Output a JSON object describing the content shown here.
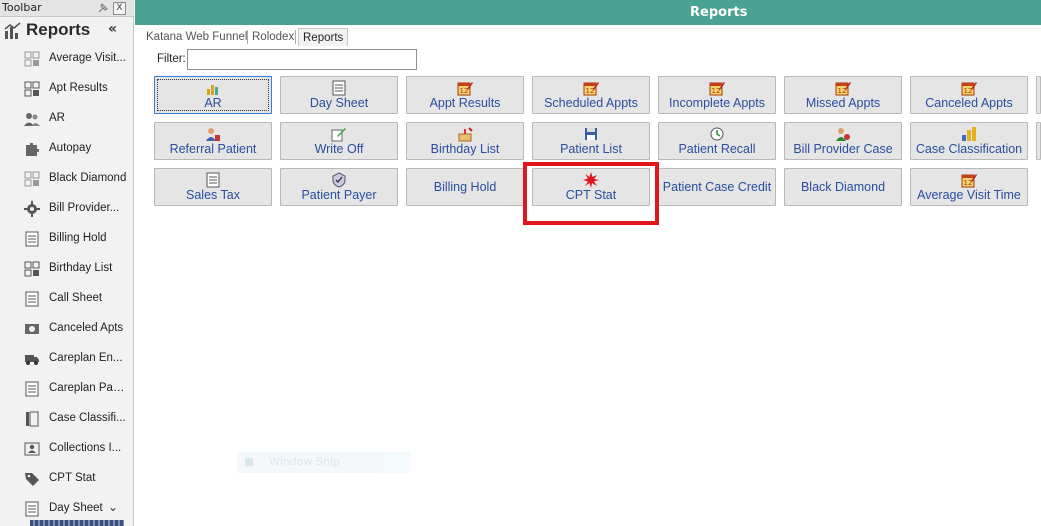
{
  "toolbar": {
    "title": "Toolbar",
    "pin_icon": "pin-icon",
    "close_label": "X",
    "section_title": "Reports",
    "section_icon": "bar-chart-icon",
    "collapse_label": "«",
    "scroll_down_label": "⌄",
    "items": [
      {
        "label": "Average Visit...",
        "icon": "grid-grey-icon"
      },
      {
        "label": "Apt Results",
        "icon": "grid-icon"
      },
      {
        "label": "AR",
        "icon": "people-icon"
      },
      {
        "label": "Autopay",
        "icon": "puzzle-icon"
      },
      {
        "label": "Black Diamond",
        "icon": "grid-grey-icon"
      },
      {
        "label": "Bill Provider...",
        "icon": "gear-icon"
      },
      {
        "label": "Billing Hold",
        "icon": "document-icon"
      },
      {
        "label": "Birthday List",
        "icon": "grid-icon"
      },
      {
        "label": "Call Sheet",
        "icon": "spreadsheet-icon"
      },
      {
        "label": "Canceled Apts",
        "icon": "money-icon"
      },
      {
        "label": "Careplan En...",
        "icon": "truck-icon"
      },
      {
        "label": "Careplan Pay...",
        "icon": "ledger-icon"
      },
      {
        "label": "Case Classifi...",
        "icon": "columns-icon"
      },
      {
        "label": "Collections I...",
        "icon": "contact-icon"
      },
      {
        "label": "CPT Stat",
        "icon": "tag-icon"
      },
      {
        "label": "Day Sheet",
        "icon": "spreadsheet-icon"
      }
    ]
  },
  "header": {
    "title": "Reports",
    "color": "#4aa392"
  },
  "tabs": [
    {
      "label": "Katana Web Funnel",
      "active": false
    },
    {
      "label": "Rolodex",
      "active": false
    },
    {
      "label": "Reports",
      "active": true
    }
  ],
  "filter": {
    "label": "Filter:",
    "value": ""
  },
  "report_buttons": [
    {
      "label": "AR",
      "icon": "money-chart-icon"
    },
    {
      "label": "Day Sheet",
      "icon": "spreadsheet-icon"
    },
    {
      "label": "Appt Results",
      "icon": "calendar-icon"
    },
    {
      "label": "Scheduled Appts",
      "icon": "calendar-icon"
    },
    {
      "label": "Incomplete Appts",
      "icon": "calendar-icon"
    },
    {
      "label": "Missed Appts",
      "icon": "calendar-icon"
    },
    {
      "label": "Canceled Appts",
      "icon": "calendar-icon"
    },
    {
      "label": "Referral Patient",
      "icon": "referral-icon"
    },
    {
      "label": "Write Off",
      "icon": "pen-paper-icon"
    },
    {
      "label": "Birthday List",
      "icon": "cake-icon"
    },
    {
      "label": "Patient List",
      "icon": "floppy-icon"
    },
    {
      "label": "Patient Recall",
      "icon": "clock-icon"
    },
    {
      "label": "Bill Provider Case",
      "icon": "provider-icon"
    },
    {
      "label": "Case Classification",
      "icon": "bar-chart-color-icon"
    },
    {
      "label": "Sales Tax",
      "icon": "spreadsheet-icon"
    },
    {
      "label": "Patient Payer",
      "icon": "shield-icon"
    },
    {
      "label": "Billing Hold",
      "icon": ""
    },
    {
      "label": "CPT Stat",
      "icon": "starburst-icon"
    },
    {
      "label": "Patient Case Credit",
      "icon": ""
    },
    {
      "label": "Black Diamond",
      "icon": ""
    },
    {
      "label": "Average Visit Time",
      "icon": "calendar-icon"
    }
  ],
  "highlight": {
    "target": "CPT Stat",
    "color": "#e0161e"
  },
  "ghost_snip": {
    "label": "Window Snip"
  }
}
